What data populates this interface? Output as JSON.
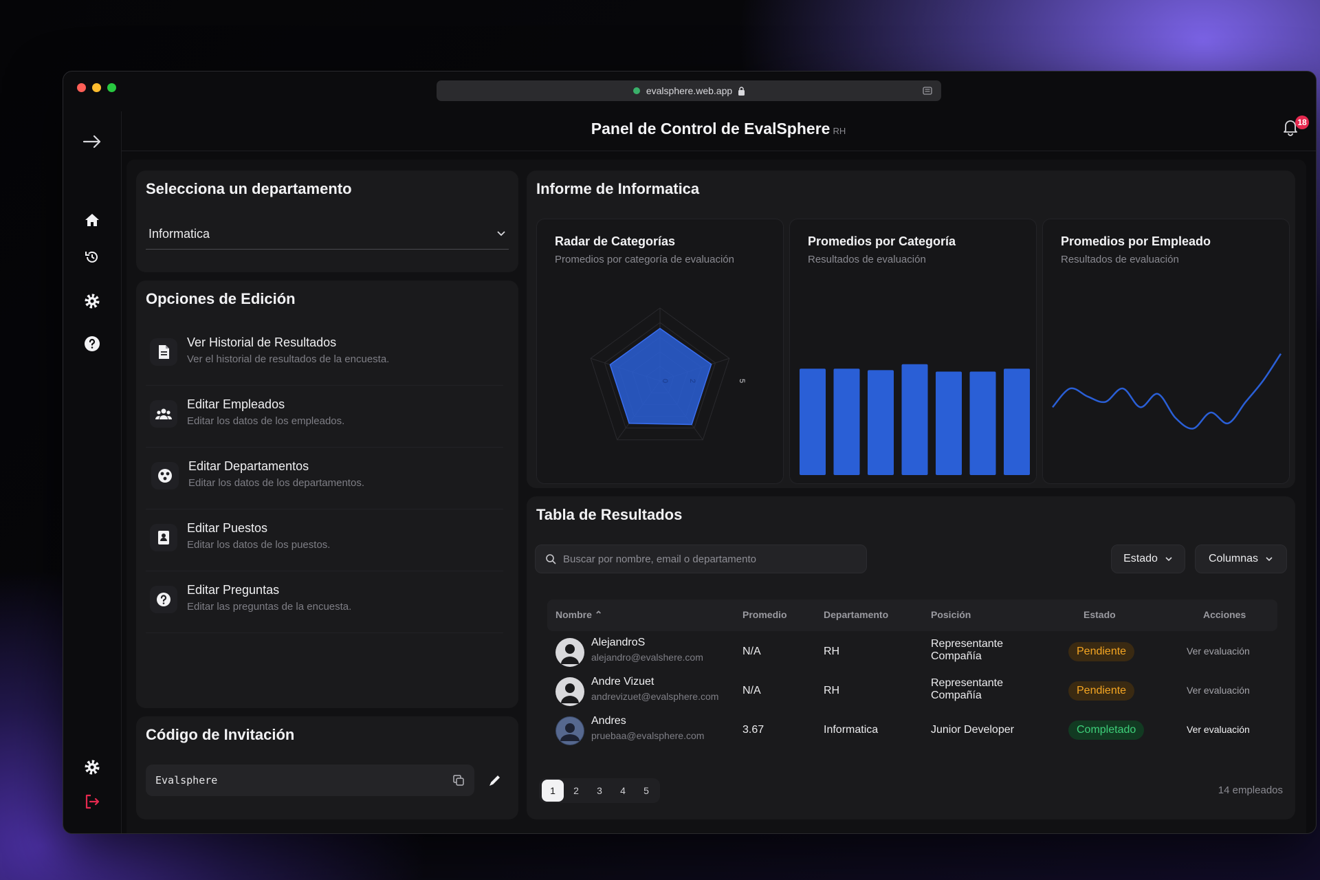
{
  "browser": {
    "url": "evalsphere.web.app"
  },
  "header": {
    "title": "Panel de Control de EvalSphere",
    "subtitle": "RH",
    "notification_count": "18"
  },
  "department": {
    "title": "Selecciona un departamento",
    "selected": "Informatica"
  },
  "edit_options": {
    "title": "Opciones de Edición",
    "items": [
      {
        "title": "Ver Historial de Resultados",
        "desc": "Ver el historial de resultados de la encuesta.",
        "icon": "document-icon"
      },
      {
        "title": "Editar Empleados",
        "desc": "Editar los datos de los empleados.",
        "icon": "users-icon"
      },
      {
        "title": "Editar Departamentos",
        "desc": "Editar los datos de los departamentos.",
        "icon": "departments-icon"
      },
      {
        "title": "Editar Puestos",
        "desc": "Editar los datos de los puestos.",
        "icon": "id-badge-icon"
      },
      {
        "title": "Editar Preguntas",
        "desc": "Editar las preguntas de la encuesta.",
        "icon": "question-icon"
      }
    ]
  },
  "invite": {
    "title": "Código de Invitación",
    "code": "Evalsphere"
  },
  "report": {
    "title": "Informe de Informatica",
    "radar": {
      "title": "Radar de Categorías",
      "desc": "Promedios por categoría de evaluación",
      "ticks": [
        "0",
        "2",
        "5"
      ]
    },
    "bars": {
      "title": "Promedios por Categoría",
      "desc": "Resultados de evaluación"
    },
    "line": {
      "title": "Promedios por Empleado",
      "desc": "Resultados de evaluación"
    }
  },
  "chart_data": [
    {
      "type": "radar",
      "title": "Radar de Categorías",
      "values": [
        3.6,
        3.7,
        3.7,
        3.6,
        3.6
      ],
      "rlim": [
        0,
        5
      ]
    },
    {
      "type": "bar",
      "title": "Promedios por Categoría",
      "values": [
        3.6,
        3.6,
        3.55,
        3.75,
        3.5,
        3.5,
        3.6
      ],
      "ylim": [
        0,
        5
      ]
    },
    {
      "type": "line",
      "title": "Promedios por Empleado",
      "values": [
        3.2,
        3.55,
        3.4,
        3.3,
        3.55,
        3.2,
        3.45,
        3.0,
        2.8,
        3.1,
        2.9,
        3.3,
        3.7,
        4.2
      ]
    }
  ],
  "table": {
    "title": "Tabla de Resultados",
    "search_placeholder": "Buscar por nombre, email o departamento",
    "filter_estado": "Estado",
    "filter_columnas": "Columnas",
    "headers": {
      "nombre": "Nombre",
      "promedio": "Promedio",
      "departamento": "Departamento",
      "posicion": "Posición",
      "estado": "Estado",
      "acciones": "Acciones"
    },
    "rows": [
      {
        "name": "AlejandroS",
        "email": "alejandro@evalshere.com",
        "promedio": "N/A",
        "departamento": "RH",
        "posicion_1": "Representante",
        "posicion_2": "Compañía",
        "estado": "Pendiente",
        "accion": "Ver evaluación"
      },
      {
        "name": "Andre Vizuet",
        "email": "andrevizuet@evalsphere.com",
        "promedio": "N/A",
        "departamento": "RH",
        "posicion_1": "Representante",
        "posicion_2": "Compañía",
        "estado": "Pendiente",
        "accion": "Ver evaluación"
      },
      {
        "name": "Andres",
        "email": "pruebaa@evalsphere.com",
        "promedio": "3.67",
        "departamento": "Informatica",
        "posicion_1": "Junior Developer",
        "posicion_2": "",
        "estado": "Completado",
        "accion": "Ver evaluación"
      }
    ],
    "pages": [
      "1",
      "2",
      "3",
      "4",
      "5"
    ],
    "total": "14 empleados"
  },
  "colors": {
    "accent": "#2a5fd6",
    "pending": "#f5a623",
    "completed": "#3ed07a",
    "logout": "#e5294f"
  }
}
